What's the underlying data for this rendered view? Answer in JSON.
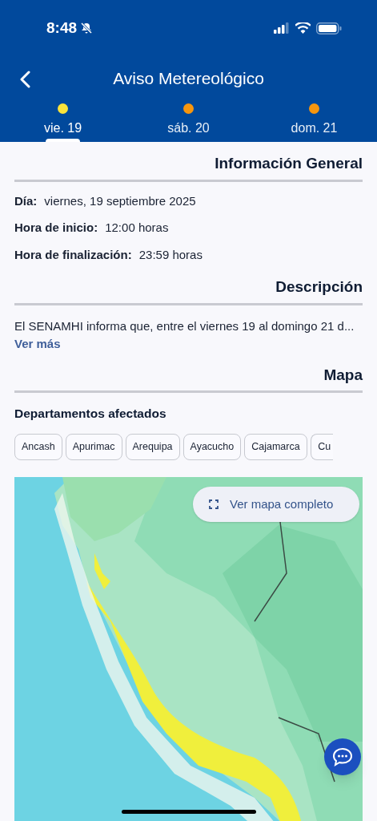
{
  "status_bar": {
    "time": "8:48"
  },
  "header": {
    "title": "Aviso Metereológico"
  },
  "tabs": [
    {
      "label": "vie. 19",
      "color": "#fbe33a",
      "selected": true
    },
    {
      "label": "sáb. 20",
      "color": "#f7960e",
      "selected": false
    },
    {
      "label": "dom. 21",
      "color": "#f7960e",
      "selected": false
    }
  ],
  "general": {
    "title": "Información General",
    "fields": [
      {
        "label": "Día:",
        "value": "viernes, 19 septiembre 2025"
      },
      {
        "label": "Hora de inicio:",
        "value": "12:00 horas"
      },
      {
        "label": "Hora de finalización:",
        "value": "23:59 horas"
      }
    ]
  },
  "description": {
    "title": "Descripción",
    "text": "El SENAMHI informa que, entre el viernes 19 al domingo 21 d...",
    "more_link": "Ver más"
  },
  "map": {
    "title": "Mapa",
    "departments_title": "Departamentos afectados",
    "departments": [
      "Ancash",
      "Apurimac",
      "Arequipa",
      "Ayacucho",
      "Cajamarca",
      "Cu"
    ],
    "full_map_button": "Ver mapa completo",
    "kind": "picture"
  }
}
